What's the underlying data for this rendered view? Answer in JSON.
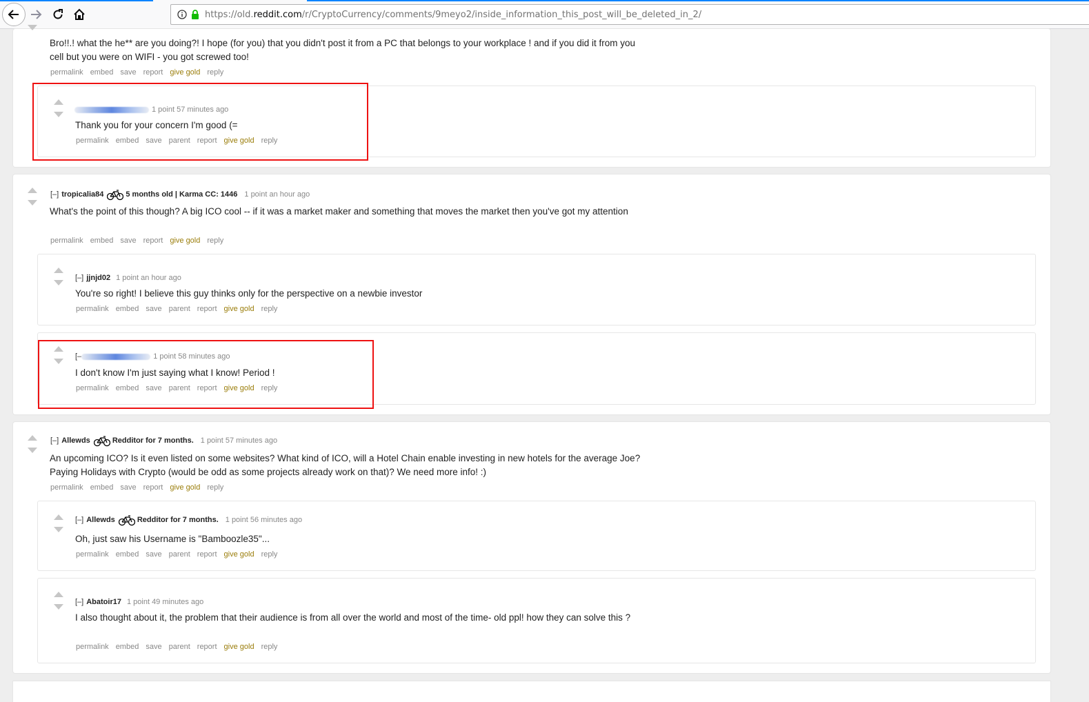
{
  "browser": {
    "url_prefix": "https://old.",
    "url_domain": "reddit.com",
    "url_path": "/r/CryptoCurrency/comments/9meyo2/inside_information_this_post_will_be_deleted_in_2/"
  },
  "actions": {
    "permalink": "permalink",
    "embed": "embed",
    "save": "save",
    "parent": "parent",
    "report": "report",
    "give_gold": "give gold",
    "reply": "reply"
  },
  "comments": {
    "c1": {
      "body": "Bro!!.! what the he** are you doing?! I hope (for you) that you didn't post it from a PC that belongs to your workplace ! and if you did it from you cell but you were on WIFI - you got screwed too!"
    },
    "c1r1": {
      "meta": "1 point 57 minutes ago",
      "body": "Thank you for your concern I'm good (="
    },
    "c2": {
      "expand": "[–]",
      "author": "tropicalia84",
      "flair": "5 months old | Karma CC: 1446",
      "meta": "1 point an hour ago",
      "body": "What's the point of this though? A big ICO cool -- if it was a market maker and something that moves the market then you've got my attention"
    },
    "c2r1": {
      "expand": "[–]",
      "author": "jjnjd02",
      "meta": "1 point an hour ago",
      "body": "You're so right! I believe this guy thinks only for the perspective on a newbie investor"
    },
    "c2r2": {
      "expand": "[–",
      "meta": "1 point 58 minutes ago",
      "body": "I don't know I'm just saying what I know! Period !"
    },
    "c3": {
      "expand": "[–]",
      "author": "Allewds",
      "flair": "Redditor for 7 months.",
      "meta": "1 point 57 minutes ago",
      "body": "An upcoming ICO? Is it even listed on some websites? What kind of ICO, will a Hotel Chain enable investing in new hotels for the average Joe? Paying Holidays with Crypto (would be odd as some projects already work on that)? We need more info! :)"
    },
    "c3r1": {
      "expand": "[–]",
      "author": "Allewds",
      "flair": "Redditor for 7 months.",
      "meta": "1 point 56 minutes ago",
      "body": "Oh, just saw his Username is \"Bamboozle35\"..."
    },
    "c3r2": {
      "expand": "[–]",
      "author": "Abatoir17",
      "meta": "1 point 49 minutes ago",
      "body": "I also thought about it, the problem that their audience is from all over the world and most of the time- old ppl! how they can solve this ?"
    }
  }
}
